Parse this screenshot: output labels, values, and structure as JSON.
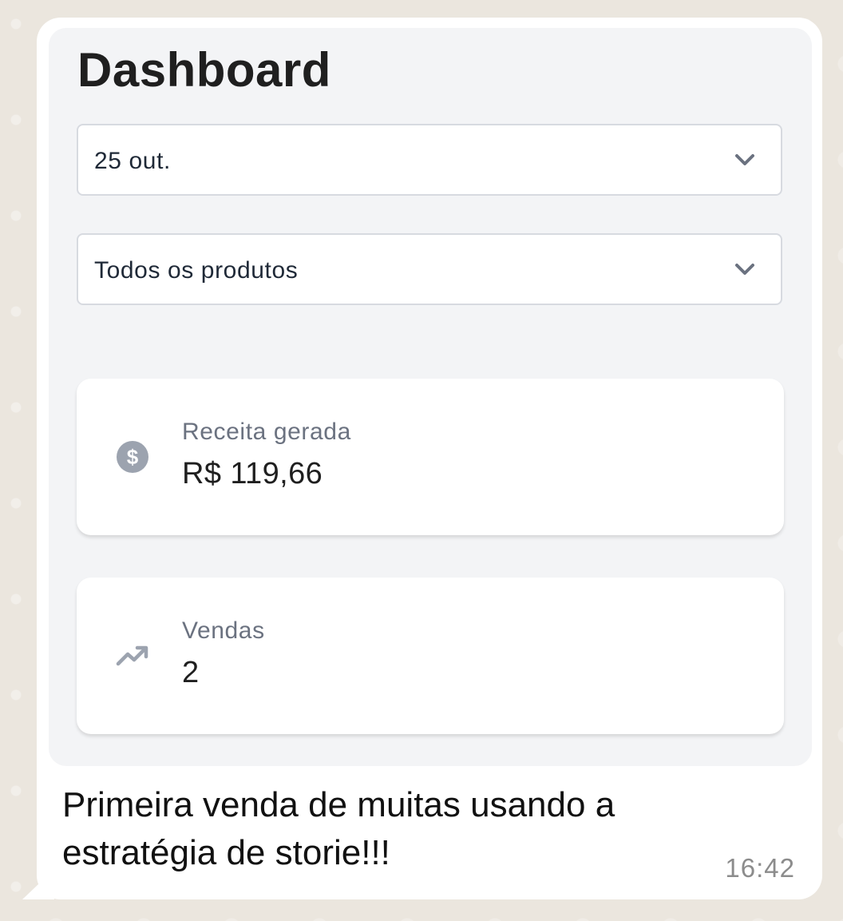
{
  "dashboard": {
    "title": "Dashboard",
    "date_select": {
      "value": "25 out.",
      "icon": "chevron-down-icon"
    },
    "product_select": {
      "value": "Todos os produtos",
      "icon": "chevron-down-icon"
    },
    "cards": [
      {
        "label": "Receita gerada",
        "value": "R$ 119,66",
        "icon": "dollar-icon"
      },
      {
        "label": "Vendas",
        "value": "2",
        "icon": "trending-up-icon"
      }
    ]
  },
  "message": {
    "text": "Primeira venda de muitas usando a estratégia de storie!!!",
    "time": "16:42"
  },
  "colors": {
    "bubble": "#ffffff",
    "panel": "#f3f4f6",
    "icon": "#9ca3af",
    "wallpaper": "#ebe6de"
  }
}
